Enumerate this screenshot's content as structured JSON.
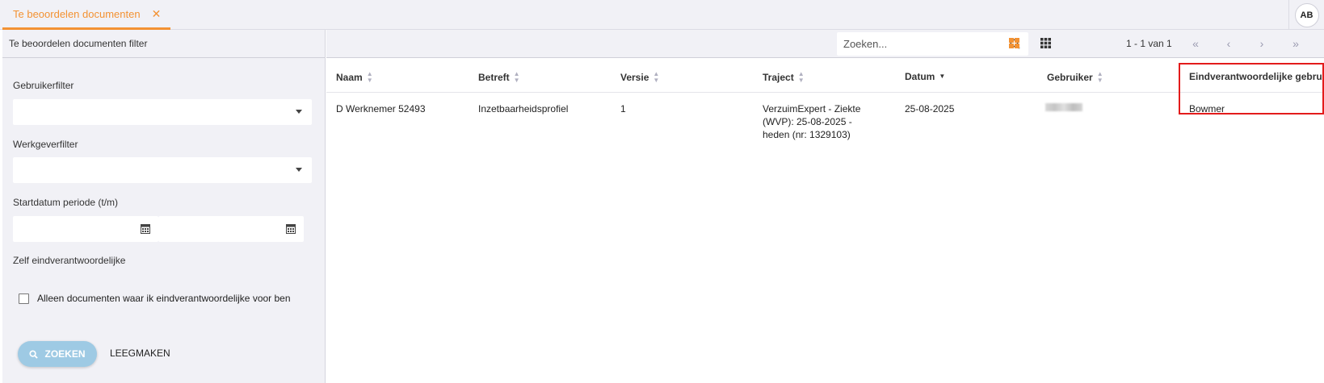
{
  "tabs": [
    {
      "label": "Te beoordelen documenten",
      "close": "✕"
    }
  ],
  "user": {
    "initials": "AB"
  },
  "filter": {
    "title": "Te beoordelen documenten filter",
    "user_filter_label": "Gebruikerfilter",
    "employer_filter_label": "Werkgeverfilter",
    "start_date_label": "Startdatum periode (t/m)",
    "self_responsible_label": "Zelf eindverantwoordelijke",
    "checkbox_label": "Alleen documenten waar ik eindverantwoordelijke voor ben",
    "checkbox_checked": false,
    "search_button": "ZOEKEN",
    "clear_button": "LEEGMAKEN"
  },
  "toolbar": {
    "search_placeholder": "Zoeken...",
    "pager_text": "1 - 1 van 1",
    "pager_first": "«",
    "pager_prev": "‹",
    "pager_next": "›",
    "pager_last": "»"
  },
  "table": {
    "columns": [
      "Naam",
      "Betreft",
      "Versie",
      "Traject",
      "Datum",
      "Gebruiker",
      "Eindverantwoordelijke gebru"
    ],
    "rows": [
      {
        "naam": "D Werknemer 52493",
        "betreft": "Inzetbaarheidsprofiel",
        "versie": "1",
        "traject": "VerzuimExpert - Ziekte (WVP): 25-08-2025 - heden (nr: 1329103)",
        "datum": "25-08-2025",
        "gebruiker": "",
        "eindverantwoordelijke": "Bowmer"
      }
    ]
  },
  "colors": {
    "accent": "#f39233",
    "highlight": "#e31b1b",
    "button": "#9ecae4"
  }
}
